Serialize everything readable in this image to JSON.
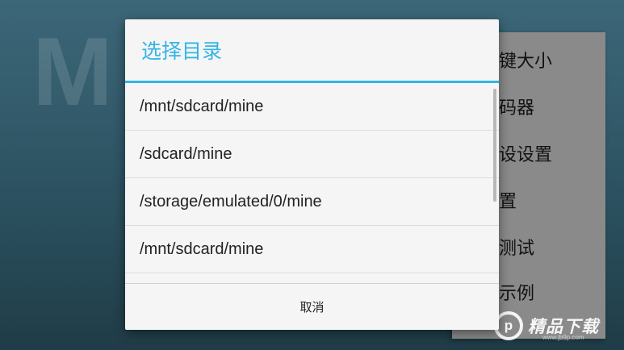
{
  "dialog": {
    "title": "选择目录",
    "items": [
      {
        "label": "/mnt/sdcard/mine"
      },
      {
        "label": "/sdcard/mine"
      },
      {
        "label": "/storage/emulated/0/mine"
      },
      {
        "label": "/mnt/sdcard/mine"
      }
    ],
    "cancel_label": "取消"
  },
  "side_menu": {
    "items": [
      {
        "label": "键大小"
      },
      {
        "label": "码器"
      },
      {
        "label": "设设置"
      },
      {
        "label": "置"
      },
      {
        "label": "测试"
      },
      {
        "label": "示例"
      }
    ]
  },
  "background": {
    "big_letter": "M"
  },
  "watermark": {
    "logo_text": "p",
    "text": "精品下载",
    "url": "www.jb9p.com"
  },
  "colors": {
    "accent": "#33b5e5",
    "dialog_bg": "#f5f5f5",
    "side_menu_bg": "#8a8a8a"
  }
}
